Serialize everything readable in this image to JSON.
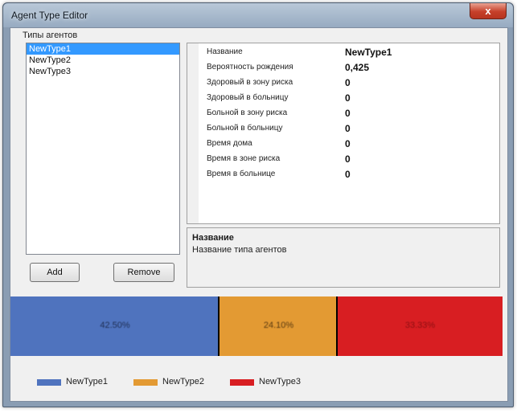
{
  "window": {
    "title": "Agent Type Editor",
    "close_glyph": "x"
  },
  "agent_types": {
    "label": "Типы агентов",
    "items": [
      "NewType1",
      "NewType2",
      "NewType3"
    ],
    "selected_index": 0
  },
  "buttons": {
    "add_label": "Add",
    "remove_label": "Remove"
  },
  "properties": [
    {
      "name": "Название",
      "value": "NewType1"
    },
    {
      "name": "Вероятность рождения",
      "value": "0,425"
    },
    {
      "name": "Здоровый в зону риска",
      "value": "0"
    },
    {
      "name": "Здоровый в больницу",
      "value": "0"
    },
    {
      "name": "Больной в зону риска",
      "value": "0"
    },
    {
      "name": "Больной в больницу",
      "value": "0"
    },
    {
      "name": "Время дома",
      "value": "0"
    },
    {
      "name": "Время в зоне риска",
      "value": "0"
    },
    {
      "name": "Время в больнице",
      "value": "0"
    }
  ],
  "description": {
    "title": "Название",
    "text": "Название типа агентов"
  },
  "distribution": {
    "segments": [
      {
        "name": "NewType1",
        "percent": 42.5,
        "label": "42.50%",
        "color": "#4f73be",
        "label_color": "#1f2f55"
      },
      {
        "name": "NewType2",
        "percent": 24.1,
        "label": "24.10%",
        "color": "#e39a33",
        "label_color": "#5a3a10"
      },
      {
        "name": "NewType3",
        "percent": 33.4,
        "label": "33.33%",
        "color": "#d81e22",
        "label_color": "#8e0f12"
      }
    ],
    "legend": [
      {
        "label": "NewType1",
        "color": "#4f73be"
      },
      {
        "label": "NewType2",
        "color": "#e39a33"
      },
      {
        "label": "NewType3",
        "color": "#d81e22"
      }
    ]
  },
  "icons": {
    "close": "close-icon"
  }
}
